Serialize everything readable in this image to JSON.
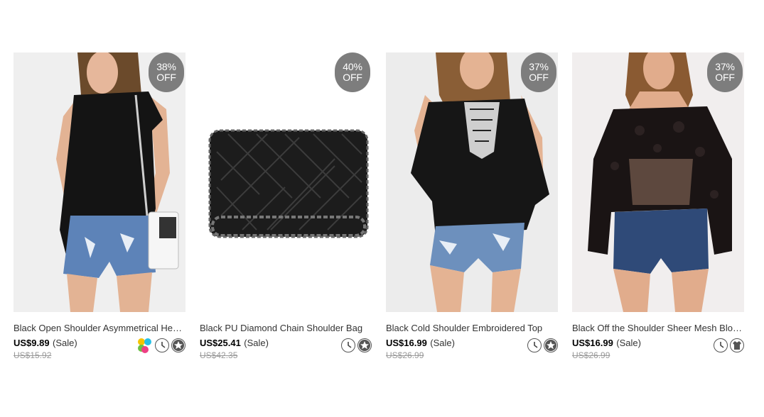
{
  "products": [
    {
      "title": "Black Open Shoulder Asymmetrical Hem T-...",
      "price": "US$9.89",
      "sale_label": "(Sale)",
      "old_price": "US$15.92",
      "discount_pct": "38%",
      "discount_label": "OFF",
      "icons": [
        "color-swatch-icon",
        "clock-icon",
        "star-icon"
      ]
    },
    {
      "title": "Black PU Diamond Chain Shoulder Bag",
      "price": "US$25.41",
      "sale_label": "(Sale)",
      "old_price": "US$42.35",
      "discount_pct": "40%",
      "discount_label": "OFF",
      "icons": [
        "clock-icon",
        "star-icon"
      ]
    },
    {
      "title": "Black Cold Shoulder Embroidered Top",
      "price": "US$16.99",
      "sale_label": "(Sale)",
      "old_price": "US$26.99",
      "discount_pct": "37%",
      "discount_label": "OFF",
      "icons": [
        "clock-icon",
        "star-icon"
      ]
    },
    {
      "title": "Black Off the Shoulder Sheer Mesh Blouse",
      "price": "US$16.99",
      "sale_label": "(Sale)",
      "old_price": "US$26.99",
      "discount_pct": "37%",
      "discount_label": "OFF",
      "icons": [
        "clock-icon",
        "tshirt-icon"
      ]
    }
  ],
  "colors": {
    "badge": "#7d7d7d",
    "old_price": "#999999",
    "swatches": [
      "#f5c400",
      "#26c0e6",
      "#6ac043",
      "#ee3f84"
    ]
  }
}
